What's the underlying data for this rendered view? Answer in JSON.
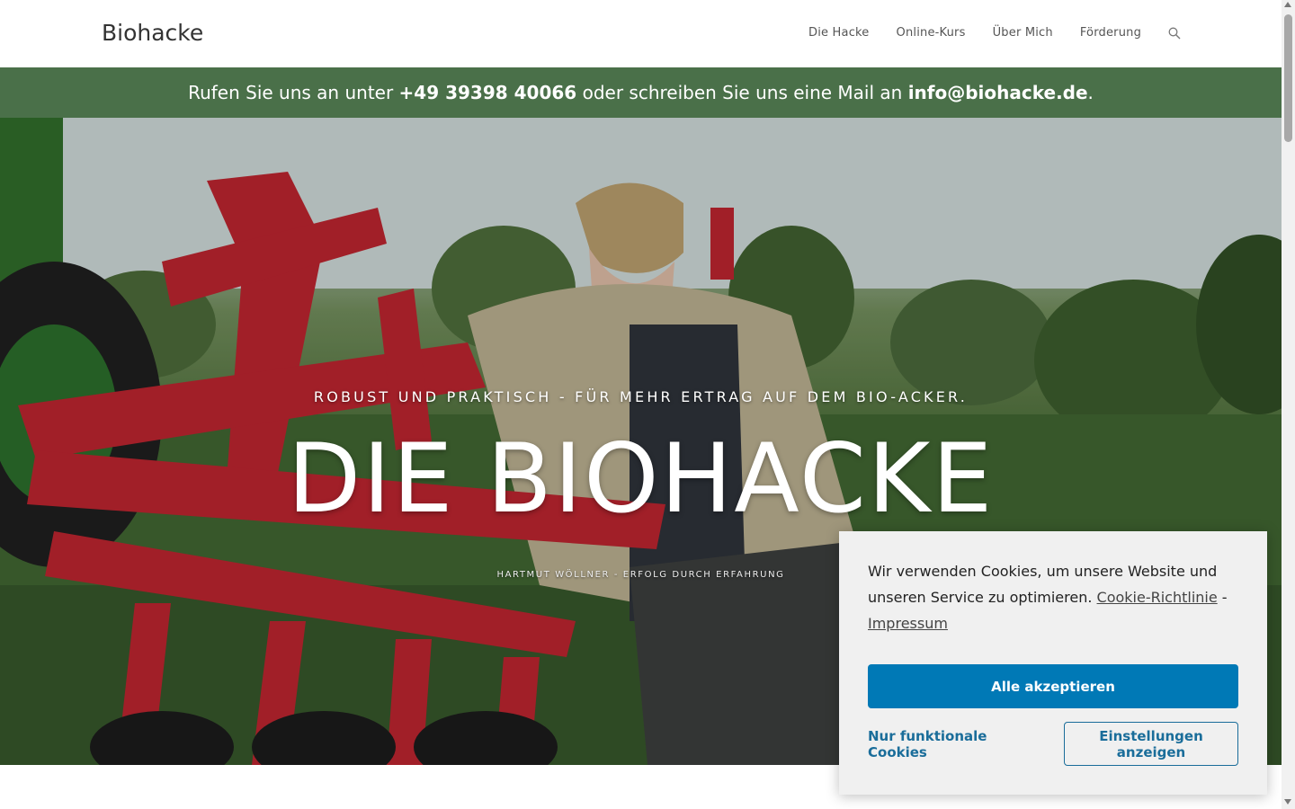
{
  "header": {
    "logo": "Biohacke",
    "nav": [
      "Die Hacke",
      "Online-Kurs",
      "Über Mich",
      "Förderung"
    ],
    "search_icon": "search-icon"
  },
  "infobar": {
    "prefix": "Rufen Sie uns an unter ",
    "phone": "+49 39398 40066",
    "middle": " oder schreiben Sie uns eine Mail an ",
    "email": "info@biohacke.de",
    "suffix": ".",
    "color": "#4a7049"
  },
  "hero": {
    "eyebrow": "ROBUST UND PRAKTISCH - FÜR MEHR ERTRAG AUF DEM BIO-ACKER.",
    "title": "DIE BIOHACKE",
    "subtitle": "HARTMUT WÖLLNER - ERFOLG DURCH ERFAHRUNG"
  },
  "cookie": {
    "text": "Wir verwenden Cookies, um unsere Website und unseren Service zu optimieren.",
    "policy_link": "Cookie-Richtlinie",
    "separator": " -",
    "imprint_link": "Impressum",
    "accept_all": "Alle akzeptieren",
    "functional_only": "Nur funktionale Cookies",
    "show_settings": "Einstellungen anzeigen",
    "accent": "#0079b6"
  }
}
